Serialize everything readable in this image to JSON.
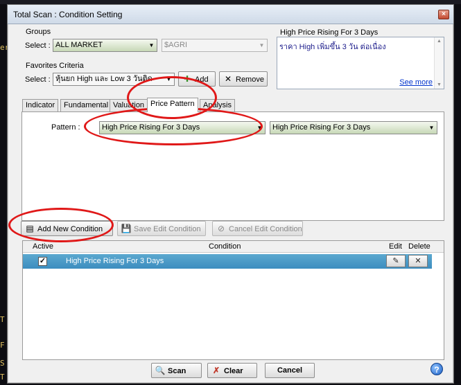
{
  "window": {
    "title": "Total Scan : Condition Setting",
    "close_glyph": "×"
  },
  "background": {
    "left_labels": [
      "er",
      "T",
      "F",
      "S",
      "T",
      "]",
      "]",
      "|"
    ]
  },
  "groups": {
    "label": "Groups",
    "select_label": "Select :",
    "market_value": "ALL MARKET",
    "sector_value": "$AGRI"
  },
  "favorites": {
    "label": "Favorites Criteria",
    "select_label": "Select :",
    "value": "หุ้นยก High และ Low 3 วันติด",
    "add_label": "Add",
    "remove_label": "Remove"
  },
  "description": {
    "title": "High Price Rising For 3 Days",
    "text": "ราคา High เพิ่มขึ้น 3 วัน ต่อเนื่อง",
    "see_more": "See more"
  },
  "tabs": [
    {
      "label": "Indicator"
    },
    {
      "label": "Fundamental"
    },
    {
      "label": "Valuation"
    },
    {
      "label": "Price Pattern"
    },
    {
      "label": "Analysis"
    }
  ],
  "pattern": {
    "label": "Pattern :",
    "value1": "High Price Rising For 3 Days",
    "value2": "High Price Rising For 3 Days"
  },
  "actions": {
    "add_new": "Add New Condition",
    "save_edit": "Save Edit Condition",
    "cancel_edit": "Cancel Edit Condition"
  },
  "grid": {
    "headers": {
      "active": "Active",
      "condition": "Condition",
      "edit": "Edit",
      "delete": "Delete"
    },
    "rows": [
      {
        "active": true,
        "condition": "High Price Rising For 3 Days"
      }
    ]
  },
  "footer": {
    "scan": "Scan",
    "clear": "Clear",
    "cancel": "Cancel",
    "help_glyph": "?"
  },
  "colors": {
    "annotation": "#e01818",
    "selected_row": "#3c8dbf",
    "combo_green": "#c7d8b6"
  },
  "icons": [
    "close-icon",
    "plus-icon",
    "x-icon",
    "document-icon",
    "save-icon",
    "cancel-icon",
    "search-icon",
    "eraser-icon",
    "help-icon",
    "pencil-icon",
    "delete-icon",
    "checkbox-icon"
  ]
}
